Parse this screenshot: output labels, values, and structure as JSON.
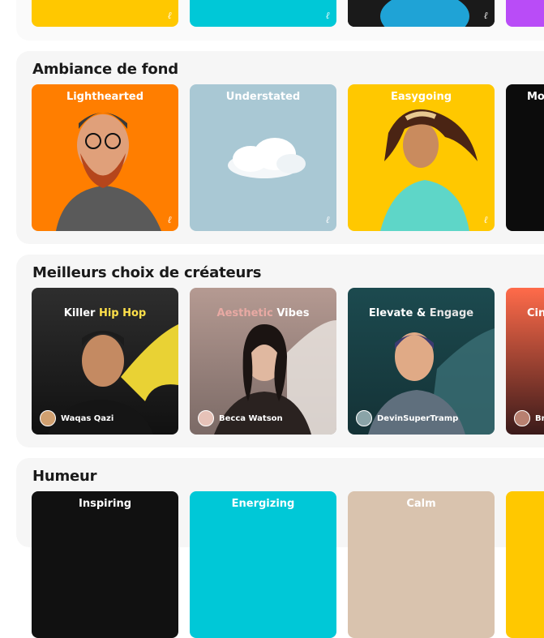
{
  "sections": [
    {
      "title": "",
      "cards": [
        {
          "title": "",
          "color": "#FFC800"
        },
        {
          "title": "",
          "color": "#00C8D7"
        },
        {
          "title": "",
          "color": "#1A1A1A"
        },
        {
          "title": "",
          "color": "#B94CF7"
        }
      ]
    },
    {
      "title": "Ambiance de fond",
      "cards": [
        {
          "title": "Lighthearted",
          "color": "#FF7E00"
        },
        {
          "title": "Understated",
          "color": "#A9C8D4"
        },
        {
          "title": "Easygoing",
          "color": "#FFC800"
        },
        {
          "title": "Mo",
          "color": "#0C0C0C"
        }
      ]
    },
    {
      "title": "Meilleurs choix de créateurs",
      "cards": [
        {
          "title_plain": "Killer",
          "title_accent": "Hip Hop",
          "accent_color": "#FFE04A",
          "creator": "Waqas Qazi"
        },
        {
          "title_plain": "Vibes",
          "title_accent": "Aesthetic",
          "accent_color": "#E8A9A3",
          "creator": "Becca Watson"
        },
        {
          "title_plain": "Elevate &",
          "title_accent": "Engage",
          "accent_color": "#E6E6E6",
          "creator": "DevinSuperTramp"
        },
        {
          "title_plain": "Cin",
          "title_accent": "",
          "accent_color": "#FFFFFF",
          "creator": "Br"
        }
      ]
    },
    {
      "title": "Humeur",
      "cards": [
        {
          "title": "Inspiring",
          "color": "#111111"
        },
        {
          "title": "Energizing",
          "color": "#00C8D7"
        },
        {
          "title": "Calm",
          "color": "#D9C3AE"
        },
        {
          "title": "",
          "color": "#FFC800"
        }
      ]
    }
  ],
  "icon_glyph": "ℓ"
}
